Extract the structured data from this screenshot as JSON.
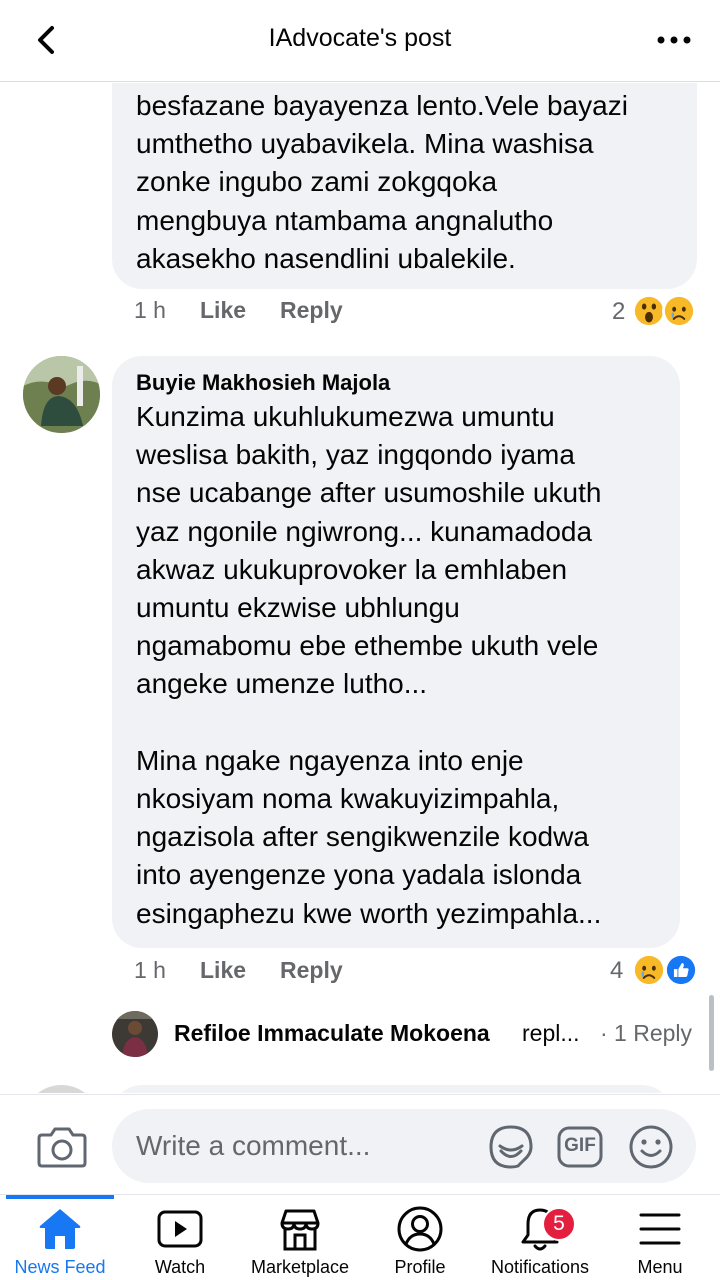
{
  "header": {
    "title": "IAdvocate's post"
  },
  "comments": [
    {
      "text": "besfazane bayayenza lento.Vele bayazi\numthetho uyabavikela. Mina washisa\nzonke ingubo zami zokgqoka\nmengbuya ntambama angnalutho\nakasekho nasendlini ubalekile.",
      "time": "1 h",
      "like_label": "Like",
      "reply_label": "Reply",
      "reaction_count": "2",
      "reactions": [
        "wow-emoji",
        "sad-emoji"
      ]
    },
    {
      "author": "Buyie Makhosieh Majola",
      "text": "Kunzima ukuhlukumezwa umuntu\nweslisa bakith, yaz ingqondo iyama\nnse ucabange after usumoshile ukuth\nyaz ngonile ngiwrong... kunamadoda\nakwaz ukukuprovoker la emhlaben\numuntu ekzwise ubhlungu\nngamabomu ebe ethembe ukuth vele\nangeke umenze lutho...\n\nMina ngake ngayenza into enje\nnkosiyam noma kwakuyizimpahla,\nngazisola after sengikwenzile kodwa\ninto ayengenze yona yadala islonda\nesingaphezu kwe worth yezimpahla...",
      "time": "1 h",
      "like_label": "Like",
      "reply_label": "Reply",
      "reaction_count": "4",
      "reactions": [
        "sad-emoji",
        "like-emoji"
      ],
      "reply_preview": {
        "name": "Refiloe Immaculate Mokoena",
        "verb": "repl...",
        "count": "· 1 Reply"
      }
    }
  ],
  "composer": {
    "placeholder": "Write a comment...",
    "gif_label": "GIF"
  },
  "tabs": [
    {
      "label": "News Feed",
      "icon": "home-icon",
      "active": true
    },
    {
      "label": "Watch",
      "icon": "watch-icon"
    },
    {
      "label": "Marketplace",
      "icon": "marketplace-icon"
    },
    {
      "label": "Profile",
      "icon": "profile-icon"
    },
    {
      "label": "Notifications",
      "icon": "bell-icon",
      "badge": "5"
    },
    {
      "label": "Menu",
      "icon": "menu-icon"
    }
  ],
  "colors": {
    "accent": "#1877f2",
    "bubble": "#f0f2f5",
    "badge": "#e41e3f",
    "secondary_text": "#65676b"
  }
}
